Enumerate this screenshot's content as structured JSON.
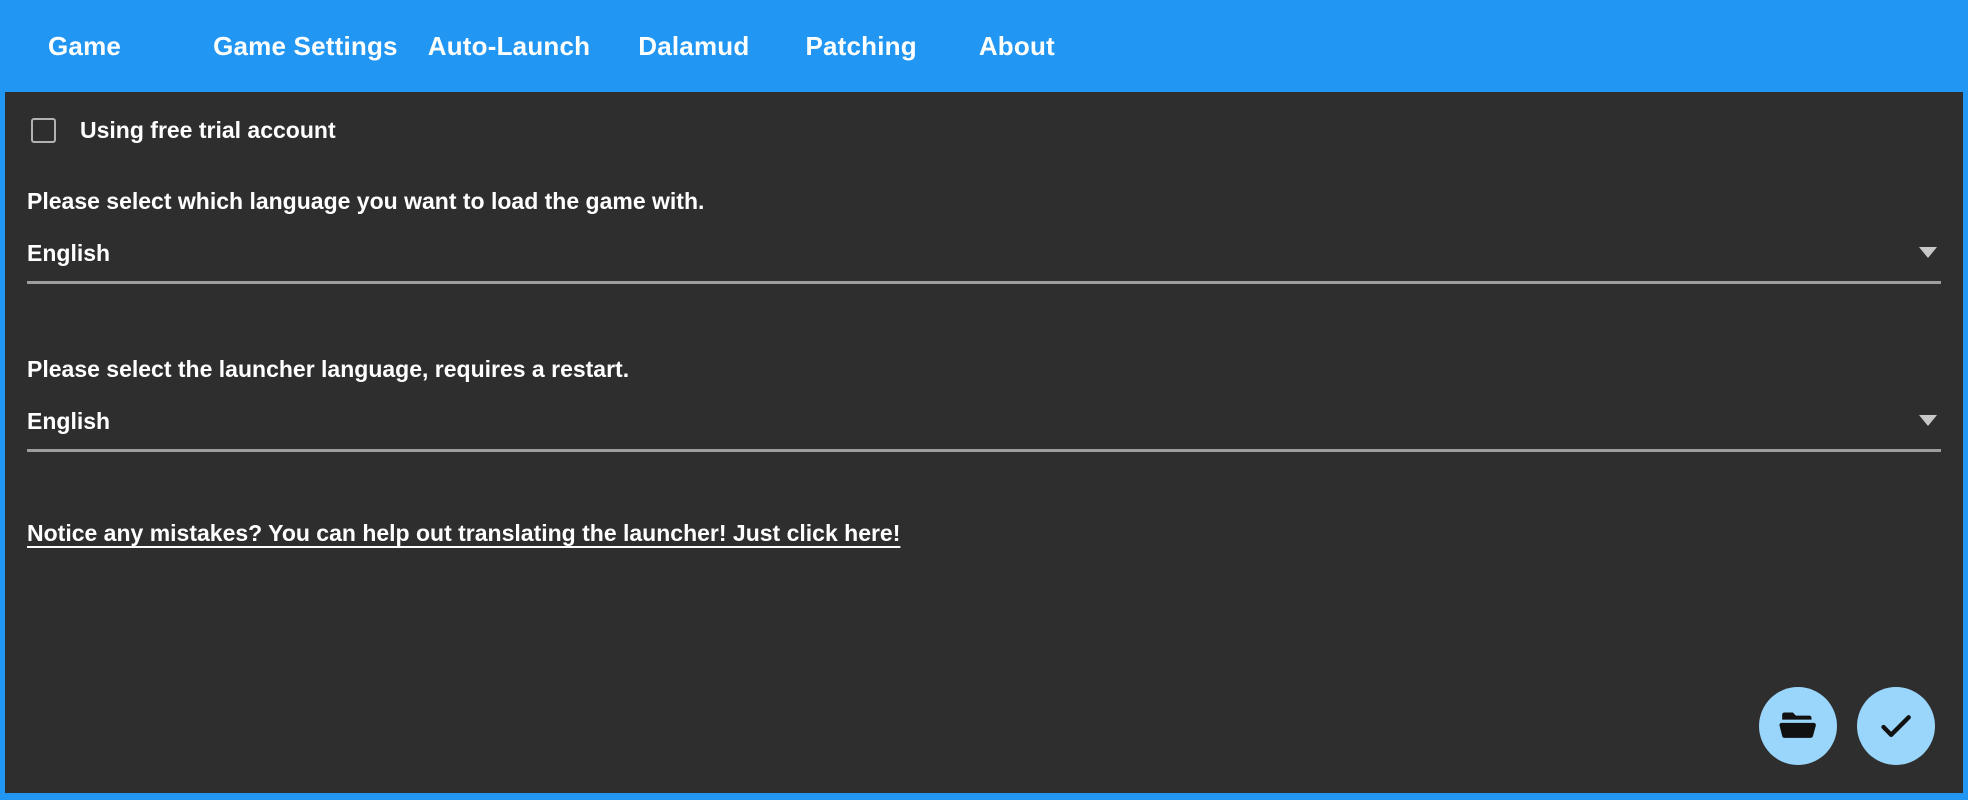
{
  "window": {
    "accent_color": "#2196f3",
    "background_color": "#2e2e2e",
    "fab_color": "#9ad6fb",
    "text_color": "#ffffff"
  },
  "tabs": [
    {
      "label": "Game",
      "selected": false
    },
    {
      "label": "Game Settings",
      "selected": true
    },
    {
      "label": "Auto-Launch",
      "selected": false
    },
    {
      "label": "Dalamud",
      "selected": false
    },
    {
      "label": "Patching",
      "selected": false
    },
    {
      "label": "About",
      "selected": false
    }
  ],
  "main": {
    "free_trial": {
      "label": "Using free trial account",
      "checked": false
    },
    "game_language": {
      "label": "Please select which language you want to load the game with.",
      "value": "English"
    },
    "launcher_language": {
      "label": "Please select the launcher language, requires a restart.",
      "value": "English"
    },
    "translate_link": "Notice any mistakes? You can help out translating the launcher! Just click here!"
  },
  "actions": {
    "open_folder": "open-folder-icon",
    "confirm": "check-icon"
  }
}
